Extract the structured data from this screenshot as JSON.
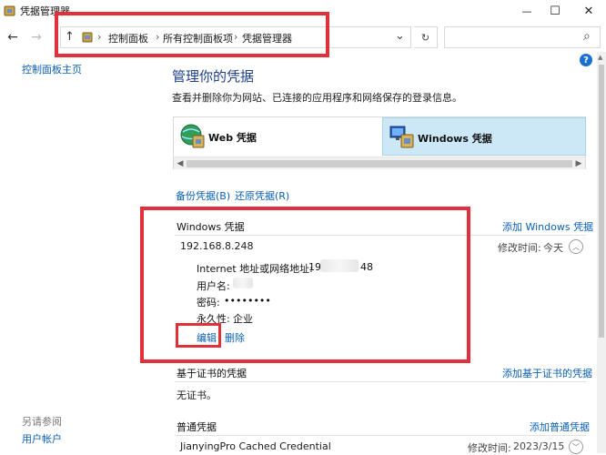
{
  "window": {
    "title": "凭据管理器",
    "minimize": "—",
    "maximize": "☐",
    "close": "✕"
  },
  "address": {
    "crumbs": [
      "控制面板",
      "所有控制面板项",
      "凭据管理器"
    ],
    "sep": "›",
    "dropdown": "⌄",
    "refresh": "↻",
    "search_icon": "⌕"
  },
  "nav": {
    "back": "←",
    "forward": "→",
    "up": "↑"
  },
  "sidebar": {
    "home": "控制面板主页",
    "see_also": "另请参阅",
    "user_accounts": "用户帐户"
  },
  "main": {
    "title": "管理你的凭据",
    "description": "查看并删除你为网站、已连接的应用程序和网络保存的登录信息。",
    "help": "?",
    "tabs": [
      {
        "label": "Web 凭据",
        "icon": "web-credential-icon"
      },
      {
        "label": "Windows 凭据",
        "icon": "windows-credential-icon"
      }
    ],
    "backup": "备份凭据(B)",
    "restore": "还原凭据(R)"
  },
  "windows_creds": {
    "header": "Windows 凭据",
    "add": "添加 Windows 凭据",
    "entry": {
      "name": "192.168.8.248",
      "modified_label": "修改时间:",
      "modified_value": "今天",
      "address_label": "Internet 地址或网络地址:",
      "address_prefix": "19",
      "address_suffix": "48",
      "username_label": "用户名:",
      "password_label": "密码:",
      "password_value": "••••••••",
      "persistence_label": "永久性:",
      "persistence_value": "企业",
      "edit": "编辑",
      "delete": "删除"
    }
  },
  "cert_creds": {
    "header": "基于证书的凭据",
    "add": "添加基于证书的凭据",
    "empty": "无证书。"
  },
  "generic_creds": {
    "header": "普通凭据",
    "add": "添加普通凭据",
    "entry": {
      "name": "JianyingPro Cached Credential",
      "modified_label": "修改时间:",
      "modified_value": "2023/3/15"
    }
  },
  "colors": {
    "accent": "#0a5fb4",
    "highlight": "#e0303a",
    "selected_tab": "#cce8f7"
  }
}
